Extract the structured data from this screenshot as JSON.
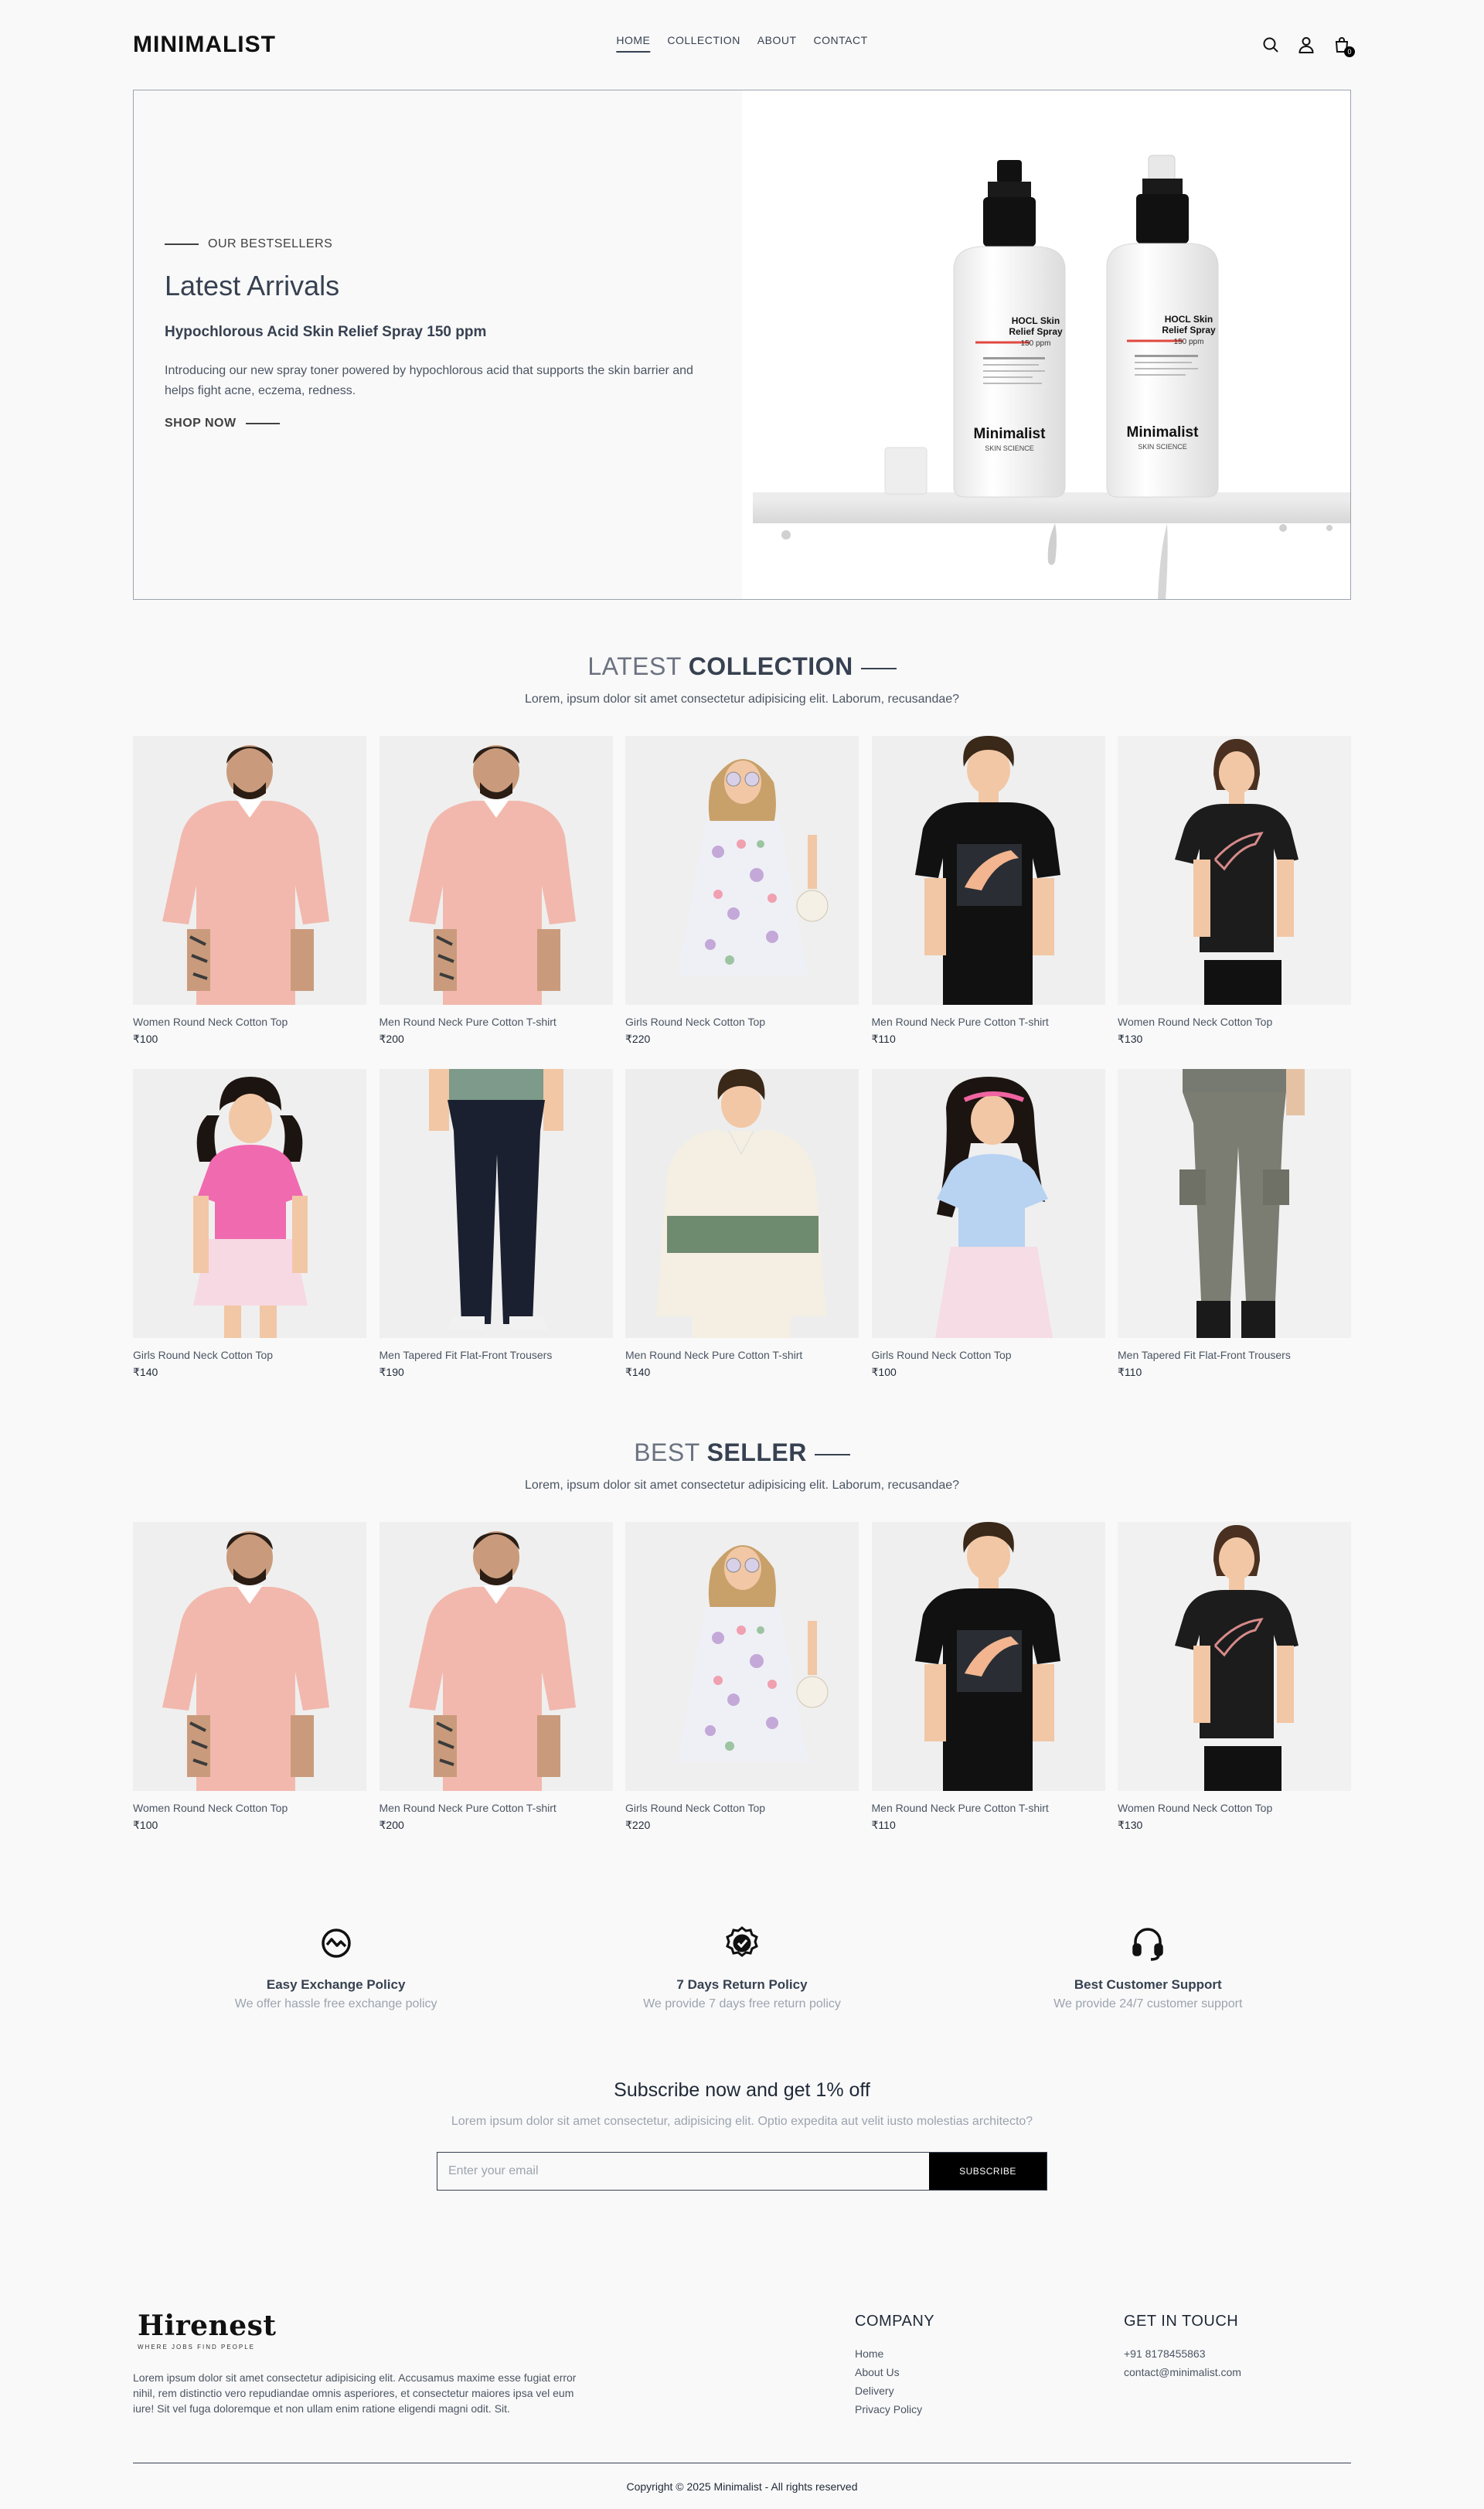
{
  "nav": {
    "logo": "MINIMALIST",
    "links": [
      "HOME",
      "COLLECTION",
      "ABOUT",
      "CONTACT"
    ],
    "cart_count": "0"
  },
  "hero": {
    "eyebrow": "OUR BESTSELLERS",
    "title": "Latest Arrivals",
    "product": "Hypochlorous Acid Skin Relief Spray 150 ppm",
    "description": "Introducing our new spray toner powered by hypochlorous acid that supports the skin barrier and helps fight acne, eczema, redness.",
    "cta": "SHOP NOW",
    "bottle_brand": "Minimalist",
    "bottle_sub": "SKIN SCIENCE",
    "bottle_label_line1": "HOCL Skin",
    "bottle_label_line2": "Relief Spray",
    "bottle_ppm": "150 ppm"
  },
  "latest": {
    "title_light": "LATEST",
    "title_bold": "COLLECTION",
    "description": "Lorem, ipsum dolor sit amet consectetur adipisicing elit. Laborum, recusandae?",
    "products": [
      {
        "name": "Women Round Neck Cotton Top",
        "price": "₹100"
      },
      {
        "name": "Men Round Neck Pure Cotton T-shirt",
        "price": "₹200"
      },
      {
        "name": "Girls Round Neck Cotton Top",
        "price": "₹220"
      },
      {
        "name": "Men Round Neck Pure Cotton T-shirt",
        "price": "₹110"
      },
      {
        "name": "Women Round Neck Cotton Top",
        "price": "₹130"
      },
      {
        "name": "Girls Round Neck Cotton Top",
        "price": "₹140"
      },
      {
        "name": "Men Tapered Fit Flat-Front Trousers",
        "price": "₹190"
      },
      {
        "name": "Men Round Neck Pure Cotton T-shirt",
        "price": "₹140"
      },
      {
        "name": "Girls Round Neck Cotton Top",
        "price": "₹100"
      },
      {
        "name": "Men Tapered Fit Flat-Front Trousers",
        "price": "₹110"
      }
    ]
  },
  "bestseller": {
    "title_light": "BEST",
    "title_bold": "SELLER",
    "description": "Lorem, ipsum dolor sit amet consectetur adipisicing elit. Laborum, recusandae?",
    "products": [
      {
        "name": "Women Round Neck Cotton Top",
        "price": "₹100"
      },
      {
        "name": "Men Round Neck Pure Cotton T-shirt",
        "price": "₹200"
      },
      {
        "name": "Girls Round Neck Cotton Top",
        "price": "₹220"
      },
      {
        "name": "Men Round Neck Pure Cotton T-shirt",
        "price": "₹110"
      },
      {
        "name": "Women Round Neck Cotton Top",
        "price": "₹130"
      }
    ]
  },
  "policies": [
    {
      "icon": "exchange-icon",
      "title": "Easy Exchange Policy",
      "desc": "We offer hassle free exchange policy"
    },
    {
      "icon": "check-badge-icon",
      "title": "7 Days Return Policy",
      "desc": "We provide 7 days free return policy"
    },
    {
      "icon": "headset-icon",
      "title": "Best Customer Support",
      "desc": "We provide 24/7 customer support"
    }
  ],
  "subscribe": {
    "title": "Subscribe now and get 1% off",
    "description": "Lorem ipsum dolor sit amet consectetur, adipisicing elit. Optio expedita aut velit iusto molestias architecto?",
    "placeholder": "Enter your email",
    "button": "SUBSCRIBE"
  },
  "footer": {
    "brand": "Hirenest",
    "tagline": "WHERE JOBS FIND PEOPLE",
    "about": "Lorem ipsum dolor sit amet consectetur adipisicing elit. Accusamus maxime esse fugiat error nihil, rem distinctio vero repudiandae omnis asperiores, et consectetur maiores ipsa vel eum iure! Sit vel fuga doloremque et non ullam enim ratione eligendi magni odit. Sit.",
    "company_title": "COMPANY",
    "company_links": [
      "Home",
      "About Us",
      "Delivery",
      "Privacy Policy"
    ],
    "contact_title": "GET IN TOUCH",
    "phone": "+91 8178455863",
    "email": "contact@minimalist.com",
    "copyright": "Copyright © 2025 Minimalist - All rights reserved"
  },
  "colors": {
    "text_dark": "#1f2937",
    "text_muted": "#9ca3af",
    "skin_pink": "#f0b9ad",
    "black_tee": "#111111",
    "stripe_green": "#6f8b6f"
  }
}
